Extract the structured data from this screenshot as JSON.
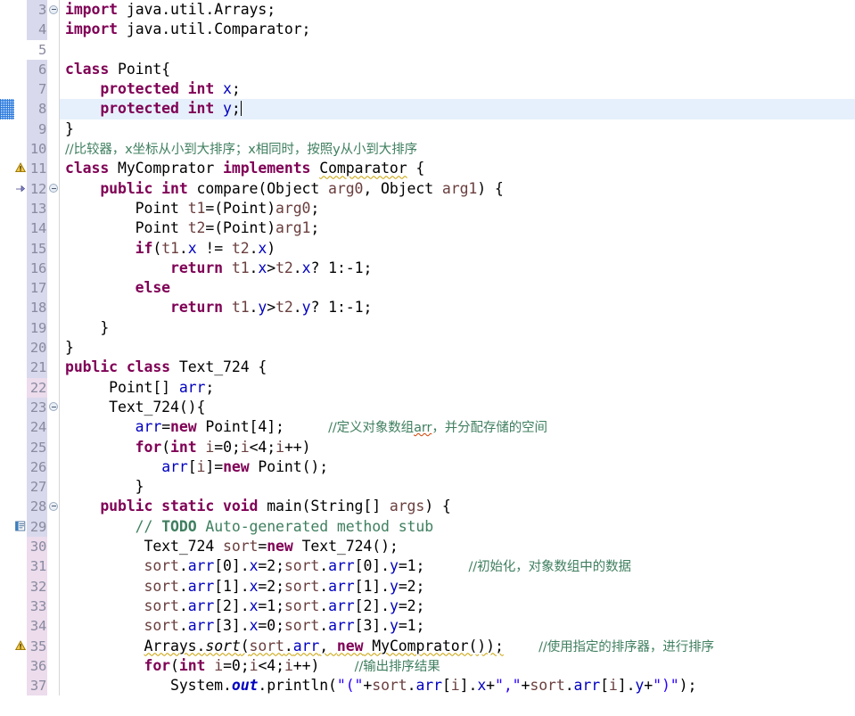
{
  "editor": {
    "app": "eclipse-java-editor",
    "language": "Java",
    "first_line": 3,
    "last_line": 37,
    "current_line": 8,
    "colors": {
      "keyword": "#7f0055",
      "comment": "#3f7f5f",
      "string": "#2a00ff",
      "field": "#0000c0",
      "gutter_text": "#8a8aa0",
      "gutter_selected_bg": "#d9d9ed",
      "gutter_changed_bg": "#ecdcec",
      "current_line_bg": "#e6f0fc",
      "warning_squiggle": "#c8a000",
      "spelling_squiggle": "#d04000"
    },
    "lines": [
      {
        "n": 3,
        "gutter": "sel",
        "fold": "collapse",
        "marker": null,
        "ann": false
      },
      {
        "n": 4,
        "gutter": "sel",
        "fold": null,
        "marker": null,
        "ann": false
      },
      {
        "n": 5,
        "gutter": "none",
        "fold": null,
        "marker": null,
        "ann": false
      },
      {
        "n": 6,
        "gutter": "sel",
        "fold": null,
        "marker": null,
        "ann": false
      },
      {
        "n": 7,
        "gutter": "sel",
        "fold": null,
        "marker": null,
        "ann": false
      },
      {
        "n": 8,
        "gutter": "sel",
        "fold": null,
        "marker": null,
        "ann": true
      },
      {
        "n": 9,
        "gutter": "sel",
        "fold": null,
        "marker": null,
        "ann": false
      },
      {
        "n": 10,
        "gutter": "sel",
        "fold": null,
        "marker": null,
        "ann": false
      },
      {
        "n": 11,
        "gutter": "sel",
        "fold": null,
        "marker": "warning",
        "ann": false
      },
      {
        "n": 12,
        "gutter": "sel",
        "fold": "collapse",
        "marker": "override",
        "ann": false
      },
      {
        "n": 13,
        "gutter": "sel",
        "fold": null,
        "marker": null,
        "ann": false
      },
      {
        "n": 14,
        "gutter": "sel",
        "fold": null,
        "marker": null,
        "ann": false
      },
      {
        "n": 15,
        "gutter": "sel",
        "fold": null,
        "marker": null,
        "ann": false
      },
      {
        "n": 16,
        "gutter": "sel",
        "fold": null,
        "marker": null,
        "ann": false
      },
      {
        "n": 17,
        "gutter": "sel",
        "fold": null,
        "marker": null,
        "ann": false
      },
      {
        "n": 18,
        "gutter": "sel",
        "fold": null,
        "marker": null,
        "ann": false
      },
      {
        "n": 19,
        "gutter": "sel",
        "fold": null,
        "marker": null,
        "ann": false
      },
      {
        "n": 20,
        "gutter": "sel",
        "fold": null,
        "marker": null,
        "ann": false
      },
      {
        "n": 21,
        "gutter": "sel",
        "fold": null,
        "marker": null,
        "ann": false
      },
      {
        "n": 22,
        "gutter": "chg",
        "fold": null,
        "marker": null,
        "ann": false
      },
      {
        "n": 23,
        "gutter": "sel",
        "fold": "collapse",
        "marker": null,
        "ann": false
      },
      {
        "n": 24,
        "gutter": "sel",
        "fold": null,
        "marker": null,
        "ann": false
      },
      {
        "n": 25,
        "gutter": "sel",
        "fold": null,
        "marker": null,
        "ann": false
      },
      {
        "n": 26,
        "gutter": "sel",
        "fold": null,
        "marker": null,
        "ann": false
      },
      {
        "n": 27,
        "gutter": "sel",
        "fold": null,
        "marker": null,
        "ann": false
      },
      {
        "n": 28,
        "gutter": "sel",
        "fold": "collapse",
        "marker": null,
        "ann": false
      },
      {
        "n": 29,
        "gutter": "sel",
        "fold": null,
        "marker": "todo",
        "ann": false
      },
      {
        "n": 30,
        "gutter": "chg",
        "fold": null,
        "marker": null,
        "ann": false
      },
      {
        "n": 31,
        "gutter": "chg",
        "fold": null,
        "marker": null,
        "ann": false
      },
      {
        "n": 32,
        "gutter": "chg",
        "fold": null,
        "marker": null,
        "ann": false
      },
      {
        "n": 33,
        "gutter": "chg",
        "fold": null,
        "marker": null,
        "ann": false
      },
      {
        "n": 34,
        "gutter": "chg",
        "fold": null,
        "marker": null,
        "ann": false
      },
      {
        "n": 35,
        "gutter": "chg",
        "fold": null,
        "marker": "warning",
        "ann": false
      },
      {
        "n": 36,
        "gutter": "chg",
        "fold": null,
        "marker": null,
        "ann": false
      },
      {
        "n": 37,
        "gutter": "chg",
        "fold": null,
        "marker": null,
        "ann": false
      }
    ],
    "source": {
      "3": "import java.util.Arrays;",
      "4": "import java.util.Comparator;",
      "5": "",
      "6": "class Point{",
      "7": "    protected int x;",
      "8": "    protected int y;",
      "9": "}",
      "10": "//比较器，x坐标从小到大排序；x相同时，按照y从小到大排序",
      "11": "class MyComprator implements Comparator {",
      "12": "    public int compare(Object arg0, Object arg1) {",
      "13": "        Point t1=(Point)arg0;",
      "14": "        Point t2=(Point)arg1;",
      "15": "        if(t1.x != t2.x)",
      "16": "            return t1.x>t2.x? 1:-1;",
      "17": "        else",
      "18": "            return t1.y>t2.y? 1:-1;",
      "19": "    }",
      "20": "}",
      "21": "public class Text_724 {",
      "22": "     Point[] arr;",
      "23": "     Text_724(){",
      "24": "        arr=new Point[4];     //定义对象数组arr，并分配存储的空间",
      "25": "        for(int i=0;i<4;i++)",
      "26": "           arr[i]=new Point();",
      "27": "        }",
      "28": "    public static void main(String[] args) {",
      "29": "        // TODO Auto-generated method stub",
      "30": "         Text_724 sort=new Text_724();",
      "31": "         sort.arr[0].x=2;sort.arr[0].y=1;     //初始化，对象数组中的数据",
      "32": "         sort.arr[1].x=2;sort.arr[1].y=2;",
      "33": "         sort.arr[2].x=1;sort.arr[2].y=2;",
      "34": "         sort.arr[3].x=0;sort.arr[3].y=1;",
      "35": "         Arrays.sort(sort.arr, new MyComprator());    //使用指定的排序器，进行排序",
      "36": "         for(int i=0;i<4;i++)    //输出排序结果",
      "37": "            System.out.println(\"(\"+sort.arr[i].x+\",\"+sort.arr[i].y+\")\");"
    },
    "comments": {
      "line10": "//比较器，x坐标从小到大排序；x相同时，按照y从小到大排序",
      "line24": "//定义对象数组arr，并分配存储的空间",
      "line29": "// TODO Auto-generated method stub",
      "line31": "//初始化，对象数组中的数据",
      "line35": "//使用指定的排序器，进行排序",
      "line36": "//输出排序结果"
    },
    "markers": {
      "warning_label": "warning-marker",
      "todo_label": "todo-task-marker",
      "override_label": "override-method-marker",
      "fold_label": "collapse-fold-marker"
    }
  }
}
